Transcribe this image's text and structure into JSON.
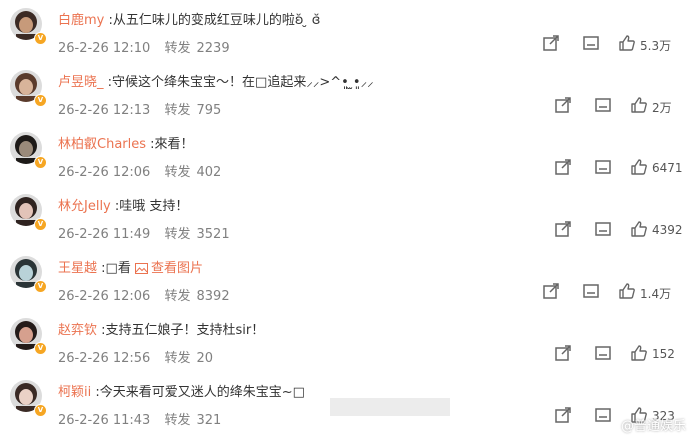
{
  "comments": [
    {
      "user": "白鹿my",
      "text": "从五仁味儿的变成红豆味儿的啦",
      "emoji_tail": "ʚ̆ ̮ ɞ̆",
      "date": "26-2-26 12:10",
      "repost_label": "转发",
      "repost_count": "2239",
      "likes": "5.3万"
    },
    {
      "user": "卢昱晓_",
      "text": "守候这个绛朱宝宝～！在□追起来",
      "emoji_tail": "⸝⸝>^•͈ ̫•͈⸝⸝",
      "date": "26-2-26 12:13",
      "repost_label": "转发",
      "repost_count": "795",
      "likes": "2万"
    },
    {
      "user": "林柏叡Charles",
      "text": "來看！",
      "emoji_tail": "",
      "date": "26-2-26 12:06",
      "repost_label": "转发",
      "repost_count": "402",
      "likes": "6471"
    },
    {
      "user": "林允Jelly",
      "text": "哇哦 支持！",
      "emoji_tail": "",
      "date": "26-2-26 11:49",
      "repost_label": "转发",
      "repost_count": "3521",
      "likes": "4392"
    },
    {
      "user": "王星越",
      "text": "□看",
      "pic_label": "查看图片",
      "emoji_tail": "",
      "date": "26-2-26 12:06",
      "repost_label": "转发",
      "repost_count": "8392",
      "likes": "1.4万"
    },
    {
      "user": "赵弈钦",
      "text": "支持五仁娘子！支持杜sir！",
      "emoji_tail": "",
      "date": "26-2-26 12:56",
      "repost_label": "转发",
      "repost_count": "20",
      "likes": "152"
    },
    {
      "user": "柯颖ii",
      "text": "今天来看可爱又迷人的绛朱宝宝~",
      "emoji_tail": "□",
      "date": "26-2-26 11:43",
      "repost_label": "转发",
      "repost_count": "321",
      "likes": "323"
    }
  ],
  "watermark": "@普通娱乐",
  "colors": {
    "username": "#eb7350",
    "meta": "#808080",
    "badge": "#f6a623"
  },
  "icons": [
    "share-icon",
    "comment-icon",
    "like-icon",
    "picture-icon",
    "verified-badge-icon"
  ]
}
